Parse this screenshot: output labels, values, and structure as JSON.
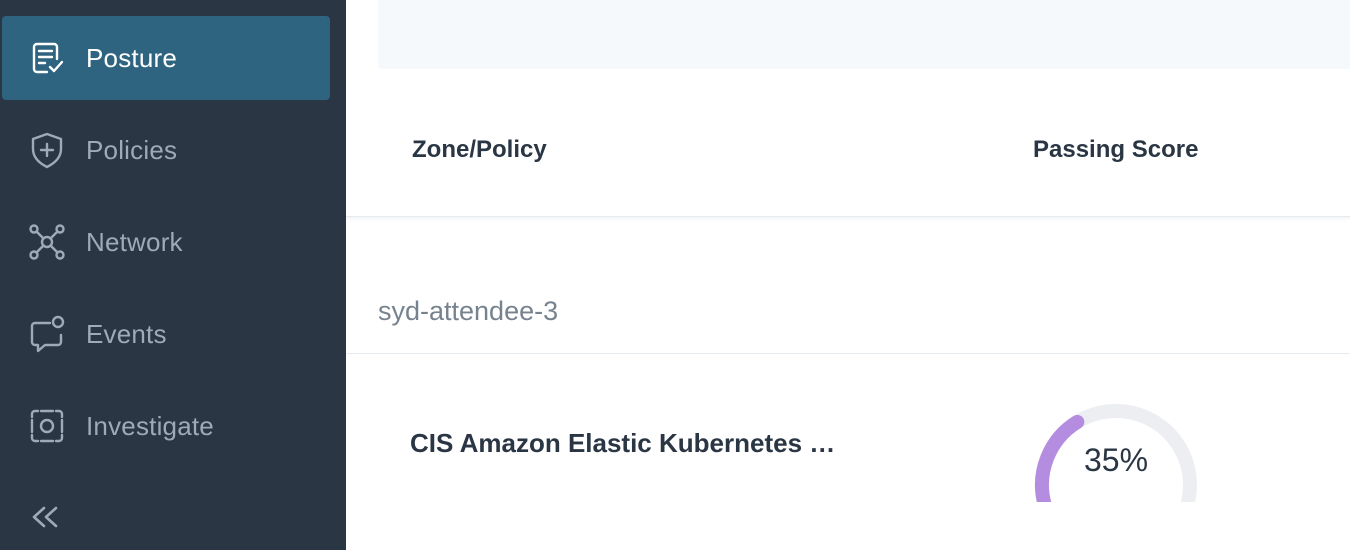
{
  "sidebar": {
    "items": [
      {
        "label": "Posture",
        "icon": "posture-checklist-icon",
        "active": true
      },
      {
        "label": "Policies",
        "icon": "shield-plus-icon",
        "active": false
      },
      {
        "label": "Network",
        "icon": "network-nodes-icon",
        "active": false
      },
      {
        "label": "Events",
        "icon": "chat-bubble-notification-icon",
        "active": false
      },
      {
        "label": "Investigate",
        "icon": "focus-frame-icon",
        "active": false
      }
    ],
    "collapse_icon": "double-chevron-left-icon"
  },
  "table": {
    "columns": [
      "Zone/Policy",
      "Passing Score"
    ],
    "group": "syd-attendee-3",
    "rows": [
      {
        "policy": "CIS Amazon Elastic Kubernetes Service (EKS) Benchmark",
        "score": 0.35,
        "score_text": "35%"
      }
    ]
  },
  "colors": {
    "sidebar_bg": "#2a3644",
    "active_item_bg": "#2f6480",
    "gauge_fill": "#b48de0",
    "gauge_track": "#eceef2"
  }
}
